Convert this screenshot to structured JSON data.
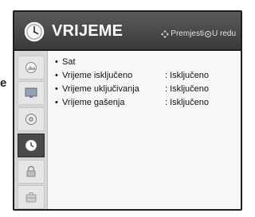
{
  "page": {
    "edge_letter": "e"
  },
  "header": {
    "title": "VRIJEME",
    "icon": "clock-icon",
    "hint_move": "Premjesti",
    "hint_ok": "U redu",
    "hint_move_icon": "navigation-arrows-icon",
    "hint_ok_icon": "ok-button-icon"
  },
  "sidebar": {
    "items": [
      {
        "icon": "picture-icon",
        "active": false
      },
      {
        "icon": "screen-icon",
        "active": false
      },
      {
        "icon": "audio-icon",
        "active": false
      },
      {
        "icon": "time-icon",
        "active": true
      },
      {
        "icon": "lock-icon",
        "active": false
      },
      {
        "icon": "option-icon",
        "active": false
      }
    ]
  },
  "menu": {
    "bullet": "•",
    "items": [
      {
        "label": "Sat",
        "value": ""
      },
      {
        "label": "Vrijeme isključeno",
        "value": ": Isključeno"
      },
      {
        "label": "Vrijeme uključivanja",
        "value": ": Isključeno"
      },
      {
        "label": "Vrijeme gašenja",
        "value": ": Isključeno"
      }
    ]
  },
  "colors": {
    "header_bg": "#4a4a4a",
    "sidebar_bg": "#d6d6d6",
    "active_item_bg": "#4a4a4a",
    "content_bg": "#f7f7f7"
  }
}
